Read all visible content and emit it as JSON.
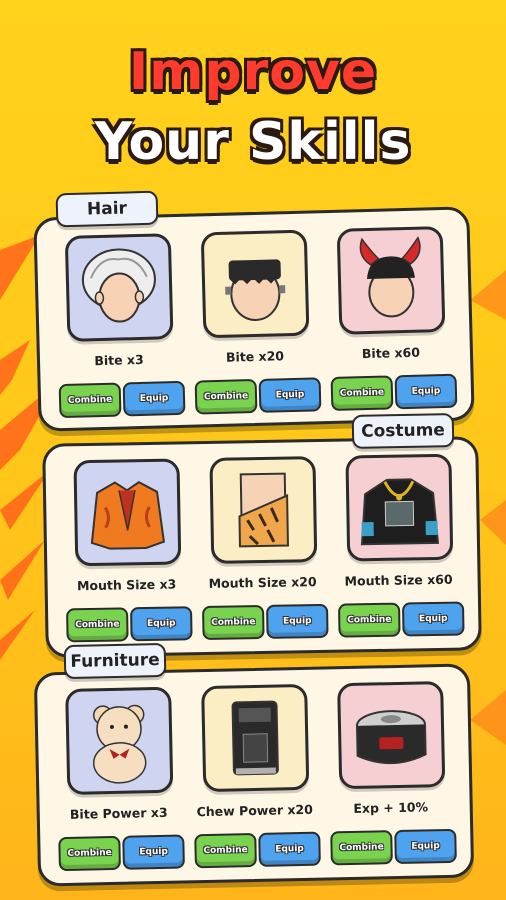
{
  "headline": {
    "line1": "Improve",
    "line2": "Your Skills"
  },
  "sections": [
    {
      "tag": "Hair",
      "items": [
        {
          "caption": "Bite x3",
          "icon": "white-hair-icon"
        },
        {
          "caption": "Bite x20",
          "icon": "frankenstein-hair-icon"
        },
        {
          "caption": "Bite x60",
          "icon": "devil-horns-hair-icon"
        }
      ]
    },
    {
      "tag": "Costume",
      "items": [
        {
          "caption": "Mouth Size x3",
          "icon": "orange-jacket-icon"
        },
        {
          "caption": "Mouth Size x20",
          "icon": "tiger-caveman-outfit-icon"
        },
        {
          "caption": "Mouth Size x60",
          "icon": "black-robe-chain-icon"
        }
      ]
    },
    {
      "tag": "Furniture",
      "items": [
        {
          "caption": "Bite Power x3",
          "icon": "teddy-bear-icon"
        },
        {
          "caption": "Chew Power x20",
          "icon": "coffee-machine-icon"
        },
        {
          "caption": "Exp + 10%",
          "icon": "rice-cooker-icon"
        }
      ]
    }
  ],
  "buttons": {
    "combine": "Combine",
    "equip": "Equip"
  },
  "colors": {
    "background": "#ffc81a",
    "title_red": "#ff3b2e",
    "combine_green": "#7ad34f",
    "equip_blue": "#4ea2ee",
    "panel": "#fff7e6"
  }
}
